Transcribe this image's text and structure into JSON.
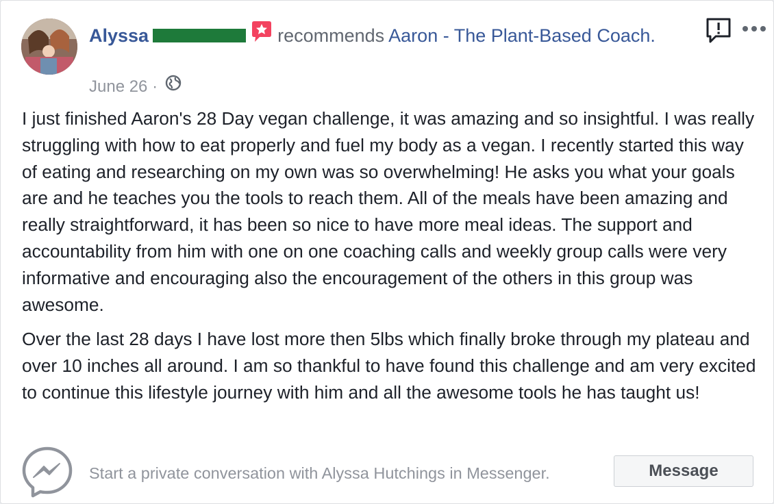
{
  "post": {
    "author_name": "Alyssa",
    "verb": "recommends",
    "page_name": "Aaron - The Plant-Based Coach.",
    "date": "June 26",
    "separator": "·"
  },
  "body": {
    "paragraphs": [
      "I just finished Aaron's 28 Day vegan challenge, it was amazing and so insightful. I was really struggling with how to eat properly and fuel my body as a vegan. I recently started this way of eating and researching on my own was so overwhelming! He asks you what your goals are and he teaches you the tools to reach them. All of the meals have been amazing and really straightforward, it has been so nice to have more meal ideas. The support and accountability from him with one on one coaching calls and weekly group calls were very informative and encouraging also the encouragement of the others in this group was awesome.",
      "Over the last 28 days I have lost more then 5lbs which finally broke through my plateau and over 10 inches all around. I am so thankful to have found this challenge and am very excited to continue this lifestyle journey with him and all the awesome tools he has taught us!"
    ]
  },
  "footer": {
    "prompt": "Start a private conversation with Alyssa Hutchings in Messenger.",
    "button_label": "Message"
  },
  "icons": {
    "recommendation": "recommendation-star-icon",
    "privacy": "globe-icon",
    "report": "report-icon",
    "more": "more-options-icon",
    "messenger": "messenger-icon"
  },
  "colors": {
    "link": "#385898",
    "badge": "#f3425f",
    "redaction": "#1e7a3a",
    "muted": "#90949c",
    "text": "#1d2129"
  }
}
